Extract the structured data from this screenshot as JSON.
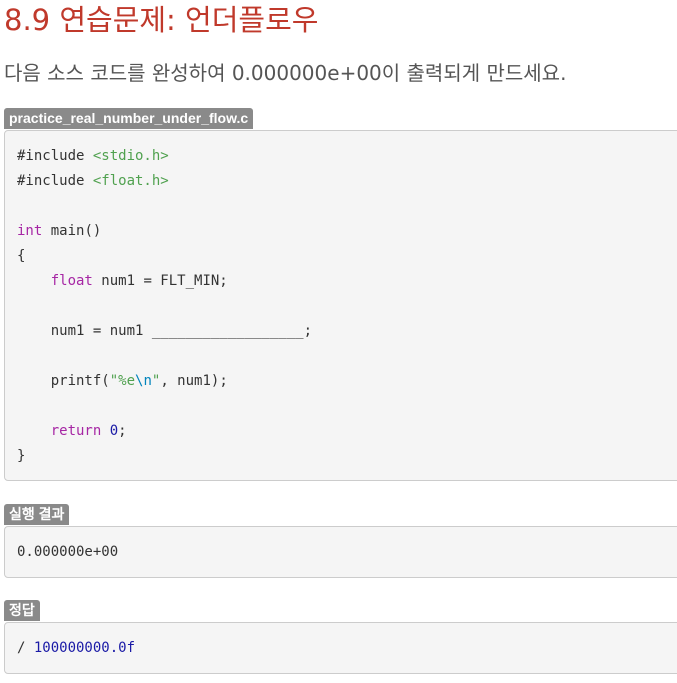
{
  "page": {
    "title": "8.9 연습문제: 언더플로우",
    "intro": "다음 소스 코드를 완성하여 0.000000e+00이 출력되게 만드세요."
  },
  "source": {
    "filename": "practice_real_number_under_flow.c",
    "lines": [
      [
        {
          "t": "#include ",
          "c": "plain"
        },
        {
          "t": "<stdio.h>",
          "c": "str"
        }
      ],
      [
        {
          "t": "#include ",
          "c": "plain"
        },
        {
          "t": "<float.h>",
          "c": "str"
        }
      ],
      [],
      [
        {
          "t": "int",
          "c": "kw"
        },
        {
          "t": " main()",
          "c": "plain"
        }
      ],
      [
        {
          "t": "{",
          "c": "plain"
        }
      ],
      [
        {
          "t": "    ",
          "c": "plain"
        },
        {
          "t": "float",
          "c": "kw"
        },
        {
          "t": " num1 = FLT_MIN;",
          "c": "plain"
        }
      ],
      [],
      [
        {
          "t": "    num1 = num1 __________________;",
          "c": "plain"
        }
      ],
      [],
      [
        {
          "t": "    printf(",
          "c": "plain"
        },
        {
          "t": "\"%e",
          "c": "str"
        },
        {
          "t": "\\n",
          "c": "esc"
        },
        {
          "t": "\"",
          "c": "str"
        },
        {
          "t": ", num1);",
          "c": "plain"
        }
      ],
      [],
      [
        {
          "t": "    ",
          "c": "plain"
        },
        {
          "t": "return",
          "c": "kw"
        },
        {
          "t": " ",
          "c": "plain"
        },
        {
          "t": "0",
          "c": "num"
        },
        {
          "t": ";",
          "c": "plain"
        }
      ],
      [
        {
          "t": "}",
          "c": "plain"
        }
      ]
    ]
  },
  "result": {
    "label": "실행 결과",
    "output": "0.000000e+00"
  },
  "answer": {
    "label": "정답",
    "tokens": [
      {
        "t": "/ ",
        "c": "plain"
      },
      {
        "t": "100000000.0f",
        "c": "num"
      }
    ]
  },
  "colors": {
    "title": "#c0392b",
    "badge": "#8a8a8a",
    "code_background": "#f5f5f5",
    "keyword": "#a626a4",
    "string": "#50a14f",
    "escape": "#0184bc",
    "number": "#1a1aa6"
  }
}
